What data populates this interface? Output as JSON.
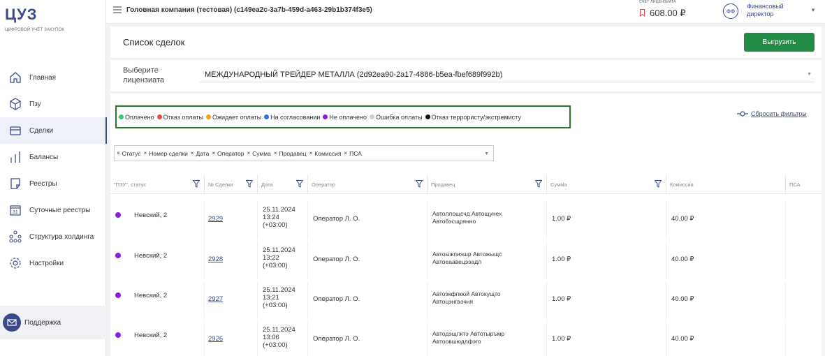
{
  "brand": {
    "logo": "ЦУЗ",
    "tagline": "ЦИФРОВОЙ УЧЁТ ЗАКУПОК"
  },
  "sidebar": {
    "items": [
      {
        "label": "Главная",
        "icon": "home-icon"
      },
      {
        "label": "Пзу",
        "icon": "cube-icon"
      },
      {
        "label": "Сделки",
        "icon": "wallet-icon",
        "active": true
      },
      {
        "label": "Балансы",
        "icon": "bars-icon"
      },
      {
        "label": "Реестры",
        "icon": "document-icon"
      },
      {
        "label": "Суточные реестры",
        "icon": "calendar-icon"
      },
      {
        "label": "Структура холдинга",
        "icon": "hierarchy-icon"
      },
      {
        "label": "Настройки",
        "icon": "gear-icon"
      }
    ],
    "support": "Поддержка"
  },
  "topbar": {
    "company": "Головная компания (тестовая) (c149ea2c-3a7b-459d-a463-29b1b374f3e5)",
    "account_label": "СЧЕТ ЛИЦЕНЗИАТА",
    "account_value": "608.00 ₽",
    "user_initials": "ФФ",
    "user_role": "Финансовый директор"
  },
  "page": {
    "title": "Список сделок",
    "export_label": "Выгрузить",
    "licensee_label": "Выберите лицензиата",
    "licensee_value": "МЕЖДУНАРОДНЫЙ ТРЕЙДЕР МЕТАЛЛА (2d92ea90-2a17-4886-b5ea-fbef689f992b)"
  },
  "legend": [
    {
      "label": "Оплачено",
      "color": "#3cc47c"
    },
    {
      "label": "Отказ оплаты",
      "color": "#e84a4a"
    },
    {
      "label": "Ожидает оплаты",
      "color": "#f0a020"
    },
    {
      "label": "На согласовании",
      "color": "#3a6fd8"
    },
    {
      "label": "Не оплачено",
      "color": "#8a1fd8"
    },
    {
      "label": "Ошибка оплаты",
      "color": "#cfcfcf"
    },
    {
      "label": "Отказ террористу/экстремисту",
      "color": "#111111"
    }
  ],
  "reset_label": "Сбросить фильтры",
  "chips": [
    "Статус",
    "Номер сделки",
    "Дата",
    "Оператор",
    "Сумма",
    "Продавец",
    "Комиссия",
    "ПСА"
  ],
  "columns": [
    {
      "label": "\"ПЗУ\", статус",
      "filter": true
    },
    {
      "label": "№ Сделки",
      "filter": true
    },
    {
      "label": "Дата",
      "filter": true
    },
    {
      "label": "Оператор",
      "filter": true
    },
    {
      "label": "Продавец",
      "filter": true
    },
    {
      "label": "Сумма",
      "filter": true
    },
    {
      "label": "Комиссия",
      "filter": false
    },
    {
      "label": "ПСА",
      "filter": false
    }
  ],
  "rows": [
    {
      "status_color": "#8a1fd8",
      "pzu": "Невский, 2",
      "deal": "2929",
      "date": "25.11.2024",
      "time": "13:24",
      "tz": "(+03:00)",
      "operator": "Оператор Л. О.",
      "seller1": "Автоллощсчд Автощунех",
      "seller2": "Автобэсщрянно",
      "sum": "1.00 ₽",
      "commission": "40.00 ₽",
      "psa": ""
    },
    {
      "status_color": "#8a1fd8",
      "pzu": "Невский, 2",
      "deal": "2928",
      "date": "25.11.2024",
      "time": "13:22",
      "tz": "(+03:00)",
      "operator": "Оператор Л. О.",
      "seller1": "Автоыжпиэшр Автожыщс",
      "seller2": "Автоеаавецээадл",
      "sum": "1.00 ₽",
      "commission": "40.00 ₽",
      "psa": ""
    },
    {
      "status_color": "#8a1fd8",
      "pzu": "Невский, 2",
      "deal": "2927",
      "date": "25.11.2024",
      "time": "13:21",
      "tz": "(+03:00)",
      "operator": "Оператор Л. О.",
      "seller1": "Автоэкфпкюй Автокущто",
      "seller2": "Автоцэнгвэчня",
      "sum": "1.00 ₽",
      "commission": "40.00 ₽",
      "psa": ""
    },
    {
      "status_color": "#8a1fd8",
      "pzu": "Невский, 2",
      "deal": "2926",
      "date": "25.11.2024",
      "time": "13:06",
      "tz": "(+03:00)",
      "operator": "Оператор Л. О.",
      "seller1": "Автодэщгжтэ Автотыръмр",
      "seller2": "Автоовшюдлфэго",
      "sum": "1.00 ₽",
      "commission": "40.00 ₽",
      "psa": ""
    }
  ]
}
